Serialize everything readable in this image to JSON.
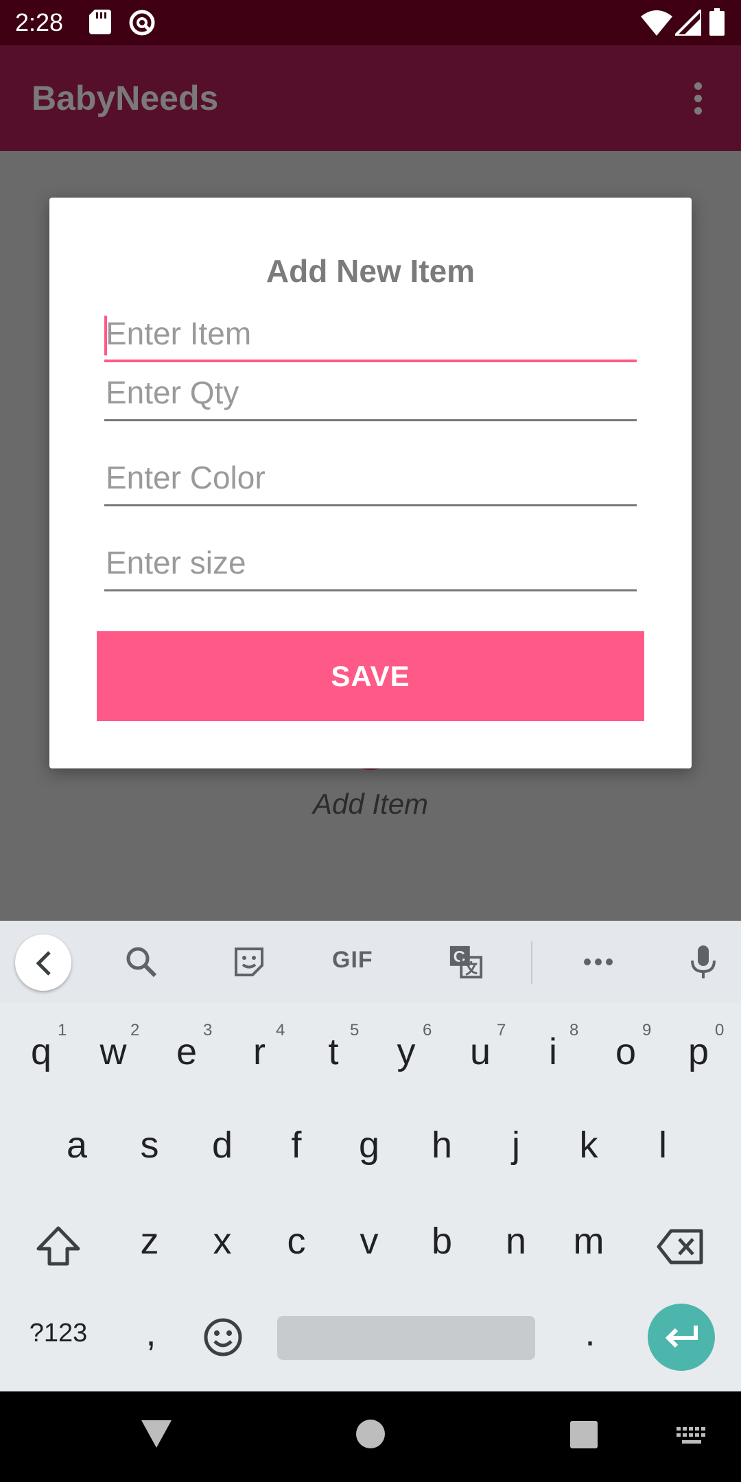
{
  "status_bar": {
    "time": "2:28",
    "icons": [
      "sd-card-icon",
      "sync-icon",
      "wifi-icon",
      "signal-icon",
      "battery-icon"
    ]
  },
  "app_bar": {
    "title": "BabyNeeds",
    "menu_icon": "more-vert-icon"
  },
  "background": {
    "add_item_label": "Add Item"
  },
  "dialog": {
    "title": "Add New Item",
    "fields": [
      {
        "placeholder": "Enter Item",
        "value": ""
      },
      {
        "placeholder": "Enter Qty",
        "value": ""
      },
      {
        "placeholder": "Enter Color",
        "value": ""
      },
      {
        "placeholder": "Enter size",
        "value": ""
      }
    ],
    "save_label": "SAVE"
  },
  "keyboard": {
    "toolbar": {
      "gif_label": "GIF",
      "icons": [
        "back-chevron-icon",
        "search-icon",
        "sticker-icon",
        "gif-icon",
        "translate-icon",
        "more-icon",
        "microphone-icon"
      ]
    },
    "row1": [
      {
        "key": "q",
        "hint": "1"
      },
      {
        "key": "w",
        "hint": "2"
      },
      {
        "key": "e",
        "hint": "3"
      },
      {
        "key": "r",
        "hint": "4"
      },
      {
        "key": "t",
        "hint": "5"
      },
      {
        "key": "y",
        "hint": "6"
      },
      {
        "key": "u",
        "hint": "7"
      },
      {
        "key": "i",
        "hint": "8"
      },
      {
        "key": "o",
        "hint": "9"
      },
      {
        "key": "p",
        "hint": "0"
      }
    ],
    "row2": [
      "a",
      "s",
      "d",
      "f",
      "g",
      "h",
      "j",
      "k",
      "l"
    ],
    "row3": [
      "z",
      "x",
      "c",
      "v",
      "b",
      "n",
      "m"
    ],
    "symbols_label": "?123",
    "comma": ",",
    "period": "."
  },
  "nav_bar": {
    "icons": [
      "back-triangle-icon",
      "home-circle-icon",
      "recents-square-icon",
      "keyboard-switch-icon"
    ]
  },
  "colors": {
    "status_bar": "#3e0012",
    "app_bar": "#560f2a",
    "accent": "#ff5a87",
    "scrim": "#6a6a6a",
    "keyboard_bg": "#e8ebee",
    "enter_key": "#4db6ac"
  }
}
